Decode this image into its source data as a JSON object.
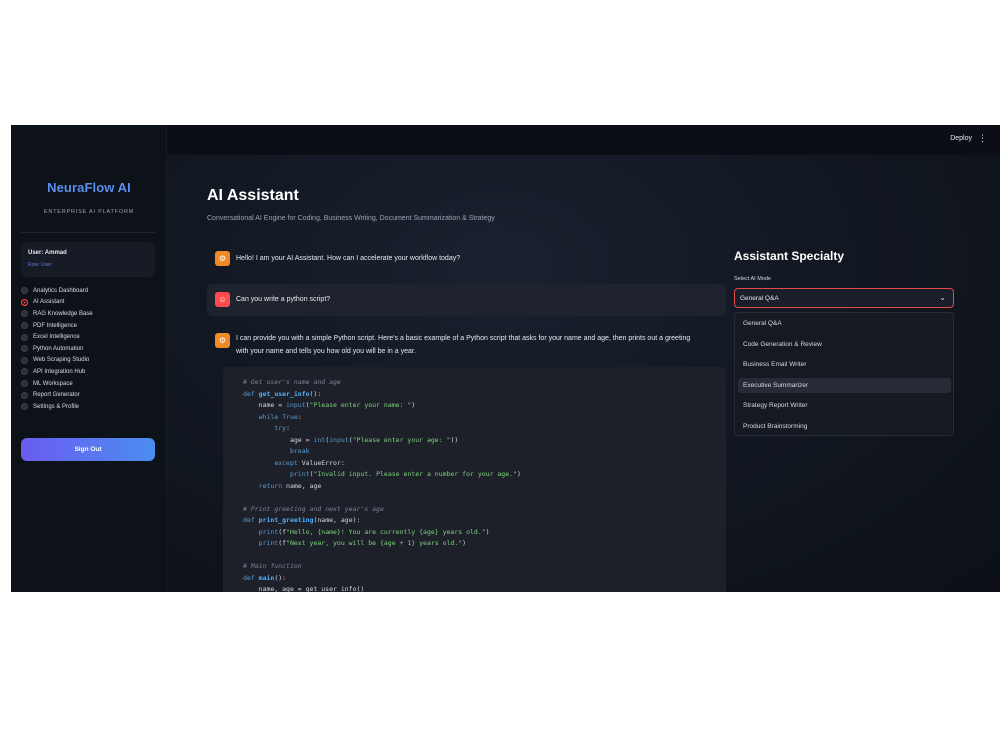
{
  "topbar": {
    "deploy": "Deploy",
    "menu_icon": "⋮"
  },
  "sidebar": {
    "brand": "NeuraFlow AI",
    "tagline": "ENTERPRISE AI PLATFORM",
    "user_name": "User: Ammad",
    "user_role": "Role: User",
    "nav": [
      "Analytics Dashboard",
      "AI Assistant",
      "RAG Knowledge Base",
      "PDF Intelligence",
      "Excel Intelligence",
      "Python Automation",
      "Web Scraping Studio",
      "API Integration Hub",
      "ML Workspace",
      "Report Generator",
      "Settings & Profile"
    ],
    "selected_nav": "AI Assistant",
    "sign_out": "Sign Out"
  },
  "main": {
    "title": "AI Assistant",
    "subtitle": "Conversational AI Engine for Coding, Business Writing, Document Summarization & Strategy",
    "messages": [
      {
        "role": "assistant",
        "text": "Hello! I am your AI Assistant. How can I accelerate your workflow today?"
      },
      {
        "role": "user",
        "text": "Can you write a python script?"
      },
      {
        "role": "assistant",
        "line1": "I can provide you with a simple Python script. Here's a basic example of a Python script that asks for your name and age, then prints out a greeting",
        "line2": "with your name and tells you how old you will be in a year."
      }
    ],
    "code": [
      "# Get user's name and age",
      "def get_user_info():",
      "    name = input(\"Please enter your name: \")",
      "    while True:",
      "        try:",
      "            age = int(input(\"Please enter your age: \"))",
      "            break",
      "        except ValueError:",
      "            print(\"Invalid input. Please enter a number for your age.\")",
      "    return name, age",
      "",
      "# Print greeting and next year's age",
      "def print_greeting(name, age):",
      "    print(f\"Hello, {name}! You are currently {age} years old.\")",
      "    print(f\"Next year, you will be {age + 1} years old.\")",
      "",
      "# Main function",
      "def main():",
      "    name, age = get_user_info()"
    ]
  },
  "specialty": {
    "title": "Assistant Specialty",
    "label": "Select AI Mode",
    "value": "General Q&A",
    "options": [
      "General Q&A",
      "Code Generation & Review",
      "Business Email Writer",
      "Executive Summarizer",
      "Strategy Report Writer",
      "Product Brainstorming"
    ],
    "highlighted": "Executive Summarizer"
  },
  "colors": {
    "accent": "#ff4b4b",
    "brand": "#5b8def",
    "bot_avatar": "#f08a24"
  }
}
